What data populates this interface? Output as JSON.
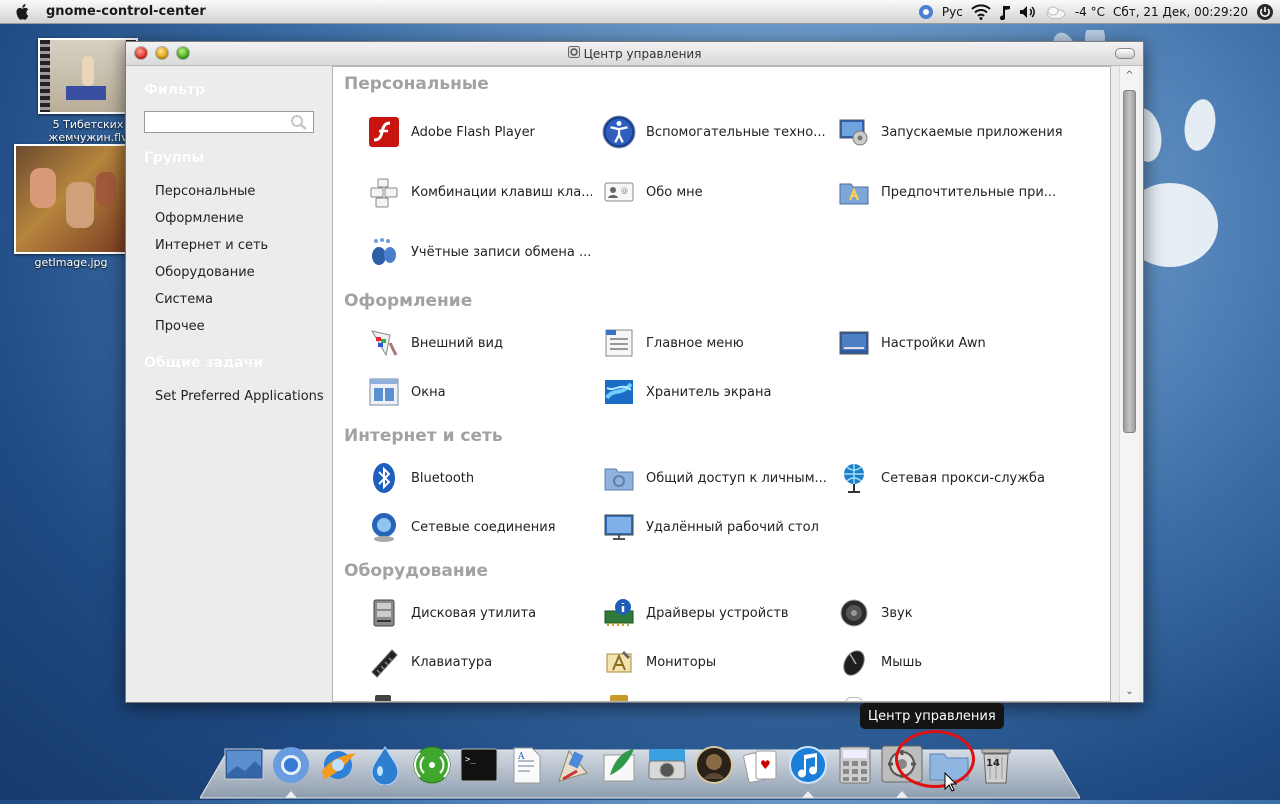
{
  "top_panel": {
    "app_name": "gnome-control-center",
    "keyboard_layout": "Рус",
    "weather": "-4 °C",
    "clock": "Сбт, 21 Дек, 00:29:20"
  },
  "desktop": {
    "icons": [
      {
        "label": "5 Тибетских жемчужин.flv"
      },
      {
        "label": "getImage.jpg"
      }
    ]
  },
  "window": {
    "title": "Центр управления",
    "sidebar": {
      "filter_heading": "Фильтр",
      "filter_value": "",
      "groups_heading": "Группы",
      "groups": [
        "Персональные",
        "Оформление",
        "Интернет и сеть",
        "Оборудование",
        "Система",
        "Прочее"
      ],
      "tasks_heading": "Общие задачи",
      "tasks": [
        "Set Preferred Applications"
      ]
    },
    "sections": [
      {
        "title": "Персональные",
        "items": [
          {
            "label": "Adobe Flash Player",
            "icon": "flash-icon"
          },
          {
            "label": "Вспомогательные техно...",
            "icon": "accessibility-icon"
          },
          {
            "label": "Запускаемые приложения",
            "icon": "startup-apps-icon"
          },
          {
            "label": "Комбинации клавиш кла...",
            "icon": "keyboard-shortcuts-icon"
          },
          {
            "label": "Обо мне",
            "icon": "about-me-icon"
          },
          {
            "label": "Предпочтительные при...",
            "icon": "preferred-apps-icon"
          },
          {
            "label": "Учётные записи обмена ...",
            "icon": "messaging-accounts-icon"
          }
        ]
      },
      {
        "title": "Оформление",
        "items": [
          {
            "label": "Внешний вид",
            "icon": "appearance-icon"
          },
          {
            "label": "Главное меню",
            "icon": "main-menu-icon"
          },
          {
            "label": "Настройки Awn",
            "icon": "awn-settings-icon"
          },
          {
            "label": "Окна",
            "icon": "windows-icon"
          },
          {
            "label": "Хранитель экрана",
            "icon": "screensaver-icon"
          }
        ]
      },
      {
        "title": "Интернет и сеть",
        "items": [
          {
            "label": "Bluetooth",
            "icon": "bluetooth-icon"
          },
          {
            "label": "Общий доступ к личным...",
            "icon": "personal-sharing-icon"
          },
          {
            "label": "Сетевая прокси-служба",
            "icon": "network-proxy-icon"
          },
          {
            "label": "Сетевые соединения",
            "icon": "network-connections-icon"
          },
          {
            "label": "Удалённый рабочий стол",
            "icon": "remote-desktop-icon"
          }
        ]
      },
      {
        "title": "Оборудование",
        "items": [
          {
            "label": "Дисковая утилита",
            "icon": "disk-utility-icon"
          },
          {
            "label": "Драйверы устройств",
            "icon": "device-drivers-icon"
          },
          {
            "label": "Звук",
            "icon": "sound-icon"
          },
          {
            "label": "Клавиатура",
            "icon": "keyboard-icon"
          },
          {
            "label": "Мониторы",
            "icon": "monitors-icon"
          },
          {
            "label": "Мышь",
            "icon": "mouse-icon"
          }
        ]
      }
    ]
  },
  "tooltip": "Центр управления",
  "dock": {
    "items": [
      {
        "icon": "desktop-icon"
      },
      {
        "icon": "chromium-icon",
        "running": true
      },
      {
        "icon": "browser-icon"
      },
      {
        "icon": "drop-icon"
      },
      {
        "icon": "network-signal-icon"
      },
      {
        "icon": "terminal-icon"
      },
      {
        "icon": "text-editor-icon"
      },
      {
        "icon": "paint-icon"
      },
      {
        "icon": "feather-icon"
      },
      {
        "icon": "camera-icon"
      },
      {
        "icon": "game-icon"
      },
      {
        "icon": "cards-icon"
      },
      {
        "icon": "music-icon",
        "running": true
      },
      {
        "icon": "calculator-icon"
      },
      {
        "icon": "control-center-icon",
        "running": true
      },
      {
        "icon": "folder-icon"
      },
      {
        "icon": "trash-icon",
        "badge": "14"
      }
    ]
  }
}
